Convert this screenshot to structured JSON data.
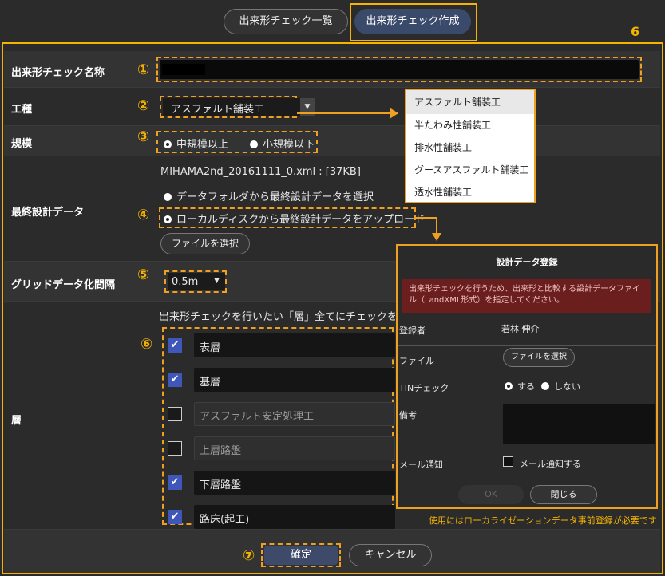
{
  "tabs": [
    "出来形チェック一覧",
    "出来形チェック作成"
  ],
  "corner_number": "6",
  "labels": {
    "name": "出来形チェック名称",
    "kind": "工種",
    "scale": "規模",
    "design": "最終設計データ",
    "grid": "グリッドデータ化間隔",
    "layer": "層"
  },
  "markers": [
    "①",
    "②",
    "③",
    "④",
    "⑤",
    "⑥",
    "⑦"
  ],
  "kind_value": "アスファルト舗装工",
  "scale_options": [
    "中規模以上",
    "小規模以下"
  ],
  "design": {
    "file": "MIHAMA2nd_20161111_0.xml : [37KB]",
    "option1": "データフォルダから最終設計データを選択",
    "option2": "ローカルディスクから最終設計データをアップロード",
    "file_button": "ファイルを選択"
  },
  "grid_value": "0.5m",
  "layer_instruction": "出来形チェックを行いたい「層」全てにチェックを入",
  "layers": [
    {
      "name": "表層",
      "checked": true
    },
    {
      "name": "基層",
      "checked": true
    },
    {
      "name": "アスファルト安定処理工",
      "checked": false
    },
    {
      "name": "上層路盤",
      "checked": false
    },
    {
      "name": "下層路盤",
      "checked": true
    },
    {
      "name": "路床(起工)",
      "checked": true
    }
  ],
  "buttons": {
    "ok": "確定",
    "cancel": "キャンセル"
  },
  "kind_menu": [
    "アスファルト舗装工",
    "半たわみ性舗装工",
    "排水性舗装工",
    "グースアスファルト舗装工",
    "透水性舗装工"
  ],
  "dialog": {
    "title": "設計データ登録",
    "alert": "出来形チェックを行うため、出来形と比較する設計データファイル（LandXML形式）を指定してください。",
    "registrant_label": "登録者",
    "registrant": "若林 伸介",
    "file_label": "ファイル",
    "file_button": "ファイルを選択",
    "tin_label": "TINチェック",
    "tin_yes": "する",
    "tin_no": "しない",
    "note_label": "備考",
    "mail_label": "メール通知",
    "mail_option": "メール通知する",
    "ok": "OK",
    "close": "閉じる"
  },
  "note": "使用にはローカライゼーションデータ事前登録が必要です",
  "colors": {
    "accent": "#f5b400",
    "dash": "#f0a020",
    "check": "#3e57b8",
    "alert_bg": "#6a1e1e"
  }
}
